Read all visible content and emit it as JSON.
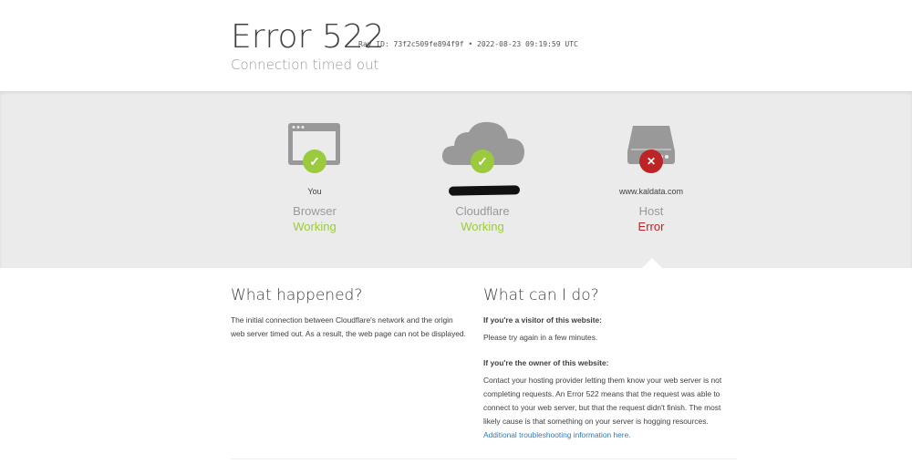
{
  "header": {
    "title": "Error 522",
    "ray_id": "Ray ID: 73f2c509fe894f9f • 2022-08-23 09:19:59 UTC",
    "subtitle": "Connection timed out"
  },
  "statuses": [
    {
      "who": "You",
      "kind": "Browser",
      "state": "Working",
      "icon": "browser-icon",
      "badge": "check-icon"
    },
    {
      "who": "",
      "kind": "Cloudflare",
      "state": "Working",
      "icon": "cloud-icon",
      "badge": "check-icon"
    },
    {
      "who": "www.kaldata.com",
      "kind": "Host",
      "state": "Error",
      "icon": "server-icon",
      "badge": "x-icon"
    }
  ],
  "colors": {
    "working": "#9bca3e",
    "error": "#bd2426",
    "icon_gray": "#999999",
    "band": "#ebebeb"
  },
  "what_happened": {
    "heading": "What happened?",
    "body": "The initial connection between Cloudflare's network and the origin web server timed out. As a result, the web page can not be displayed."
  },
  "what_can_i_do": {
    "heading": "What can I do?",
    "visitor_label": "If you're a visitor of this website:",
    "visitor_body": "Please try again in a few minutes.",
    "owner_label": "If you're the owner of this website:",
    "owner_body": "Contact your hosting provider letting them know your web server is not completing requests. An Error 522 means that the request was able to connect to your web server, but that the request didn't finish. The most likely cause is that something on your server is hogging resources.",
    "owner_link": "Additional troubleshooting information here."
  }
}
